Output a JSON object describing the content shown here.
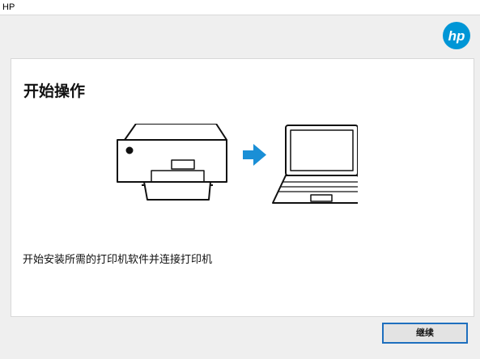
{
  "window": {
    "title": "HP"
  },
  "brand": {
    "logo_text": "hp",
    "logo_color": "#0096d6"
  },
  "page": {
    "heading": "开始操作",
    "description": "开始安装所需的打印机软件并连接打印机"
  },
  "illustration": {
    "arrow_color": "#1a8fd6"
  },
  "footer": {
    "continue_label": "继续"
  }
}
